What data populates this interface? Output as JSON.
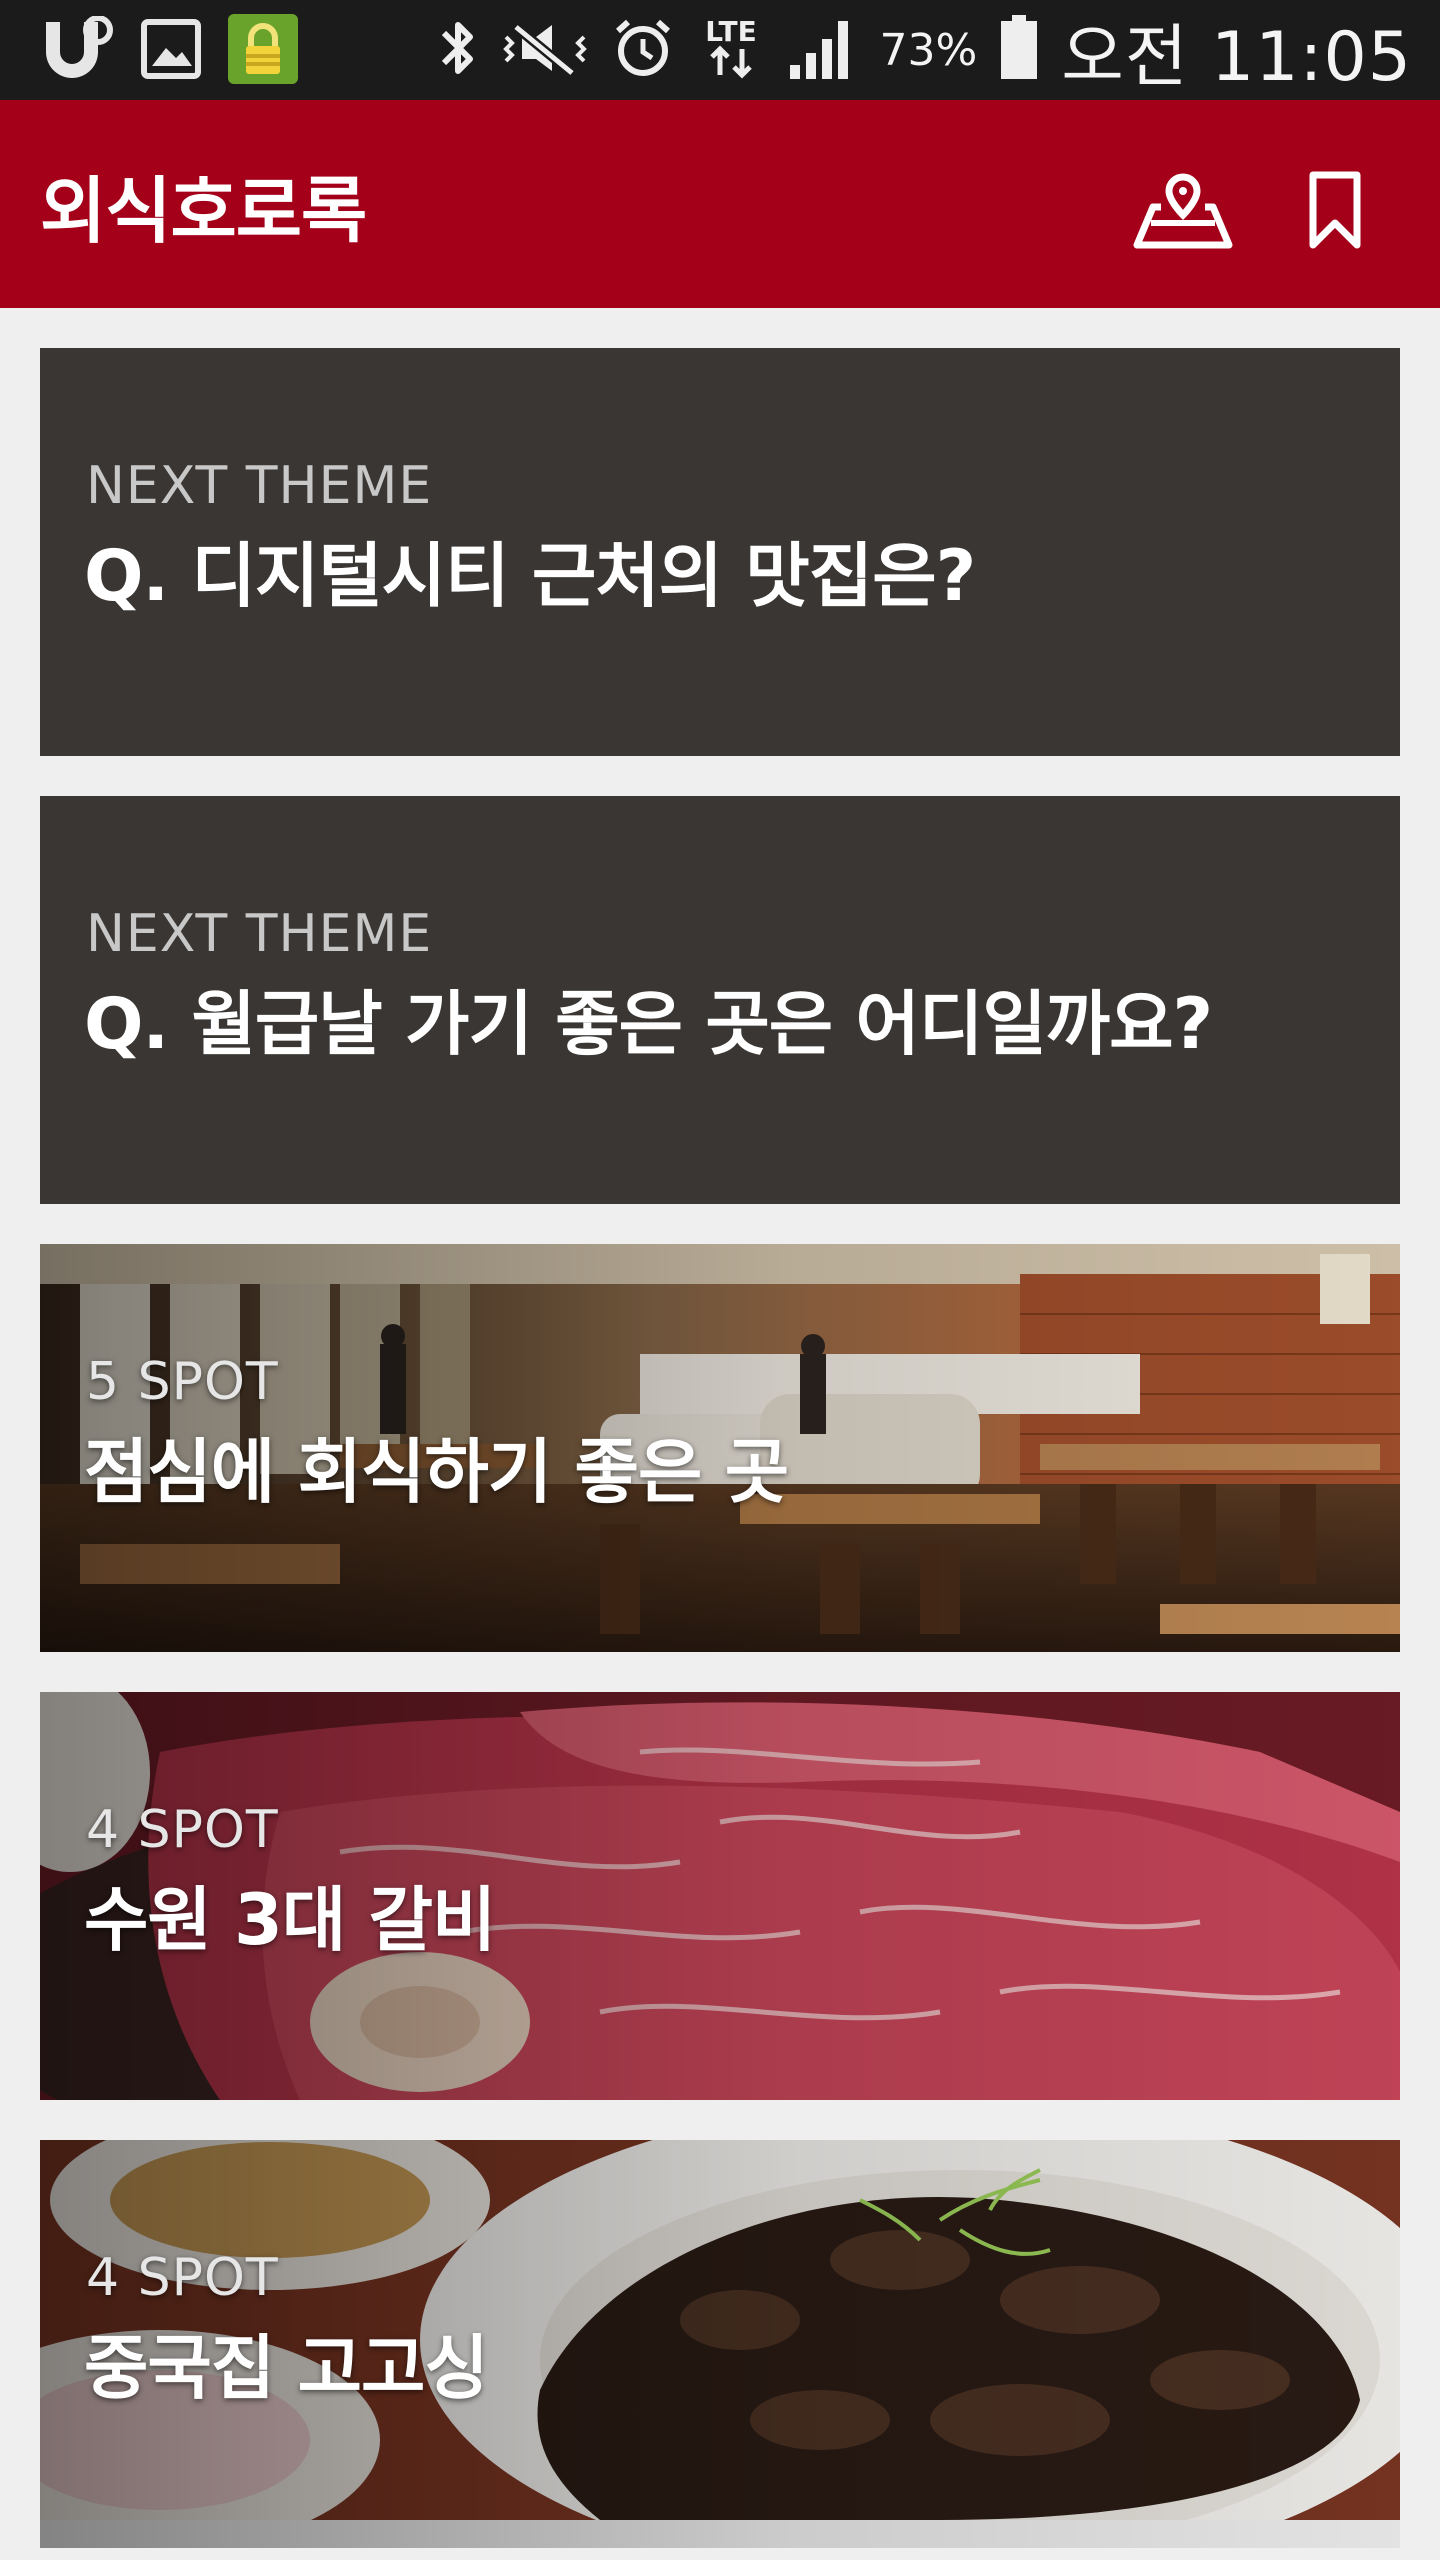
{
  "status_bar": {
    "battery_percent": "73%",
    "time": "오전 11:05",
    "network_type": "LTE",
    "left_icons": [
      "u-plus-icon",
      "gallery-icon",
      "secure-lock-icon"
    ],
    "right_icons": [
      "bluetooth-icon",
      "vibrate-mute-icon",
      "alarm-icon",
      "lte-icon",
      "signal-icon",
      "battery-icon"
    ]
  },
  "app_bar": {
    "title": "외식호로록",
    "actions": [
      "map-pin-icon",
      "bookmark-icon"
    ],
    "background_color": "#a4001a"
  },
  "cards": [
    {
      "type": "theme",
      "label": "NEXT THEME",
      "title": "Q. 디지털시티 근처의 맛집은?"
    },
    {
      "type": "theme",
      "label": "NEXT THEME",
      "title": "Q. 월급날 가기 좋은 곳은 어디일까요?"
    },
    {
      "type": "spot",
      "label": "5 SPOT",
      "title": "점심에 회식하기 좋은 곳",
      "image": "restaurant-interior"
    },
    {
      "type": "spot",
      "label": "4 SPOT",
      "title": "수원 3대 갈비",
      "image": "marbled-galbi-meat"
    },
    {
      "type": "spot",
      "label": "4 SPOT",
      "title": "중국집 고고싱",
      "image": "jjajangmyeon-dish"
    }
  ],
  "colors": {
    "theme_card": "#393633",
    "page_background": "#efefef"
  }
}
